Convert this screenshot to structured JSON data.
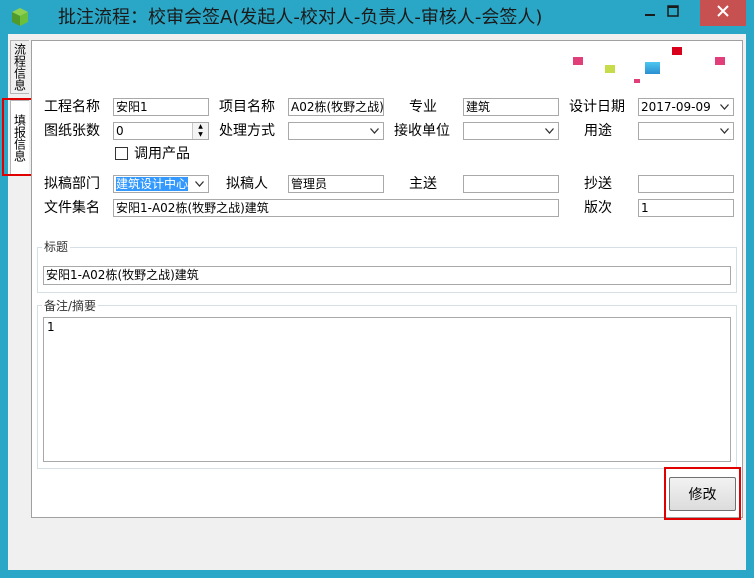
{
  "window": {
    "title": "批注流程：校审会签A(发起人-校对人-负责人-审核人-会签人)",
    "icons": {
      "app": "green-cube-icon",
      "minimize": "minimize-icon",
      "maximize": "maximize-icon",
      "close": "close-icon"
    },
    "accent_color": "#2aa7c7",
    "close_color": "#c75050"
  },
  "side_tabs": [
    {
      "label": "流程信息"
    },
    {
      "label": "填报信息"
    }
  ],
  "form": {
    "project_name_label": "工程名称",
    "project_name_value": "安阳1",
    "item_name_label": "项目名称",
    "item_name_value": "A02栋(牧野之战)",
    "specialty_label": "专业",
    "specialty_value": "建筑",
    "design_date_label": "设计日期",
    "design_date_value": "2017-09-09",
    "drawing_count_label": "图纸张数",
    "drawing_count_value": "0",
    "handling_label": "处理方式",
    "handling_value": "",
    "receiver_label": "接收单位",
    "receiver_value": "",
    "usage_label": "用途",
    "usage_value": "",
    "use_product_label": "调用产品",
    "drafting_dept_label": "拟稿部门",
    "drafting_dept_value": "建筑设计中心",
    "drafter_label": "拟稿人",
    "drafter_value": "管理员",
    "main_send_label": "主送",
    "main_send_value": "",
    "cc_label": "抄送",
    "cc_value": "",
    "file_set_label": "文件集名",
    "file_set_value": "安阳1-A02栋(牧野之战)建筑",
    "edition_label": "版次",
    "edition_value": "1"
  },
  "subject": {
    "label": "标题",
    "value": "安阳1-A02栋(牧野之战)建筑"
  },
  "remarks": {
    "label": "备注/摘要",
    "value": "1"
  },
  "actions": {
    "modify_label": "修改"
  },
  "highlight_color": "#e00000"
}
